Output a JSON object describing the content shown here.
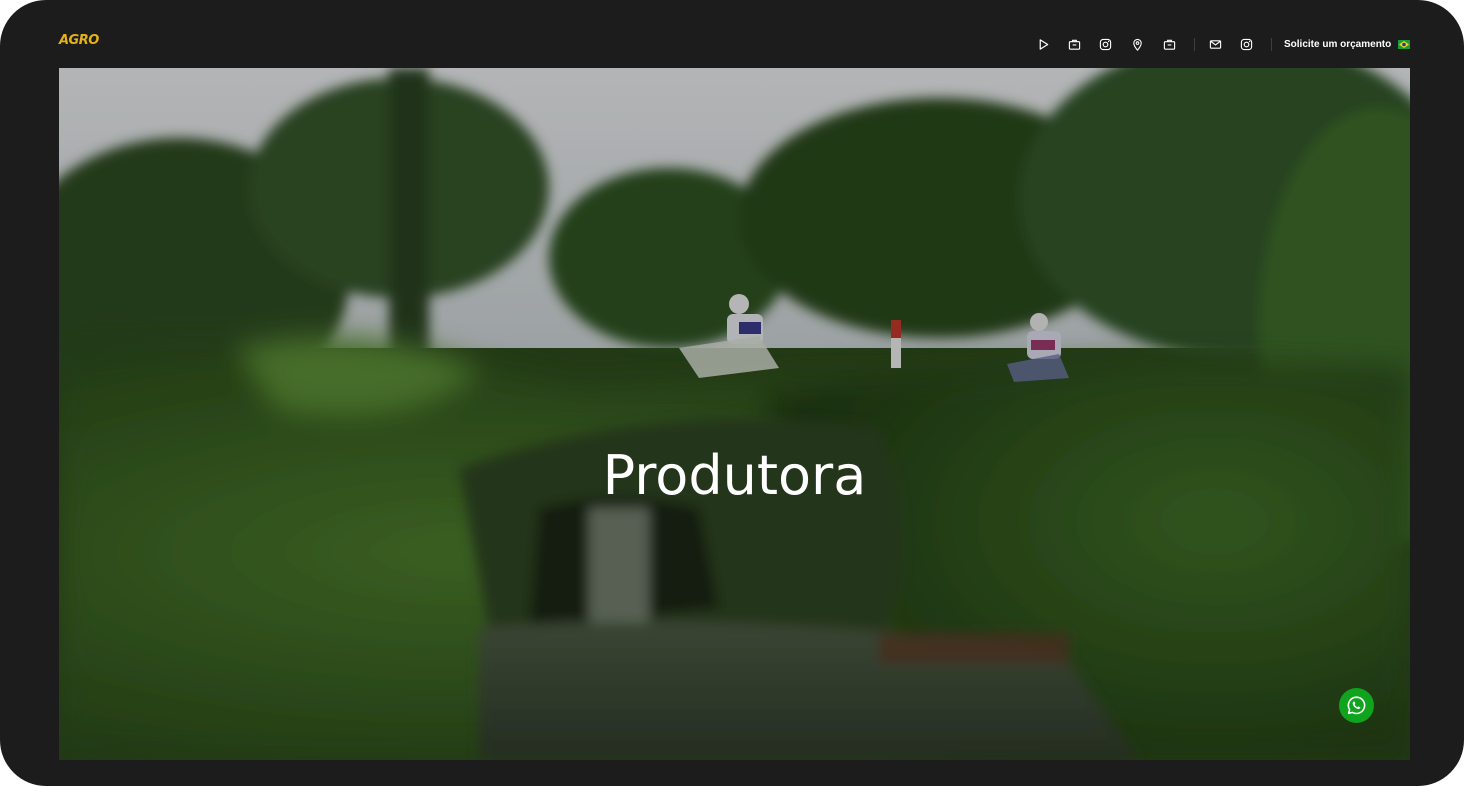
{
  "brand": {
    "logo_text": "AGRO",
    "accent_color": "#e2b21c"
  },
  "nav": {
    "icons": [
      {
        "name": "play-icon"
      },
      {
        "name": "briefcase-icon"
      },
      {
        "name": "instagram-icon"
      },
      {
        "name": "location-pin-icon"
      },
      {
        "name": "briefcase-icon"
      },
      {
        "name": "mail-icon"
      },
      {
        "name": "instagram-icon"
      }
    ],
    "quote_label": "Solicite um orçamento",
    "language_flag": "brazil-flag-icon"
  },
  "hero": {
    "title": "Produtora"
  },
  "floating": {
    "whatsapp_icon": "whatsapp-icon",
    "whatsapp_color": "#0fa31e"
  },
  "colors": {
    "background": "#1c1c1c",
    "text": "#ffffff"
  }
}
